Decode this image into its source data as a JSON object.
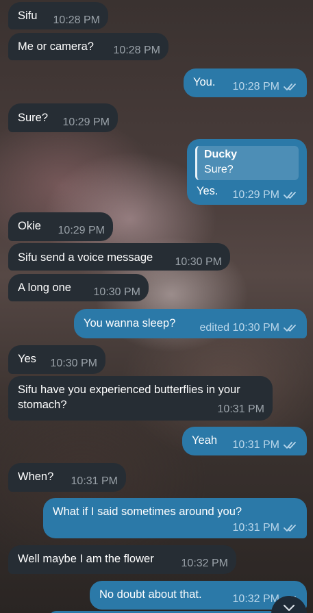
{
  "messages": [
    {
      "text": "Sifu",
      "time": "10:28 PM"
    },
    {
      "text": "Me or camera?",
      "time": "10:28 PM"
    },
    {
      "text": "You.",
      "time": "10:28 PM"
    },
    {
      "text": "Sure?",
      "time": "10:29 PM"
    },
    {
      "reply_name": "Ducky",
      "reply_text": "Sure?",
      "text": "Yes.",
      "time": "10:29 PM"
    },
    {
      "text": "Okie",
      "time": "10:29 PM"
    },
    {
      "text": "Sifu send a voice message",
      "time": "10:30 PM"
    },
    {
      "text": "A long one",
      "time": "10:30 PM"
    },
    {
      "text": "You wanna sleep?",
      "time": "edited 10:30 PM"
    },
    {
      "text": "Yes",
      "time": "10:30 PM"
    },
    {
      "text_line1": "Sifu have you experienced butterflies in your",
      "text_line2": "stomach?",
      "time": "10:31 PM"
    },
    {
      "text": "Yeah",
      "time": "10:31 PM"
    },
    {
      "text": "When?",
      "time": "10:31 PM"
    },
    {
      "text": "What if I said sometimes around you?",
      "time": "10:31 PM"
    },
    {
      "text": "Well maybe I am the flower",
      "time": "10:32 PM"
    },
    {
      "text": "No doubt about that.",
      "time": "10:32 PM"
    }
  ],
  "icons": {
    "read_receipt": "double-check-icon",
    "scroll_down": "chevron-down-icon"
  },
  "colors": {
    "incoming_bubble": "#262d34",
    "outgoing_bubble": "#2b79a8"
  }
}
